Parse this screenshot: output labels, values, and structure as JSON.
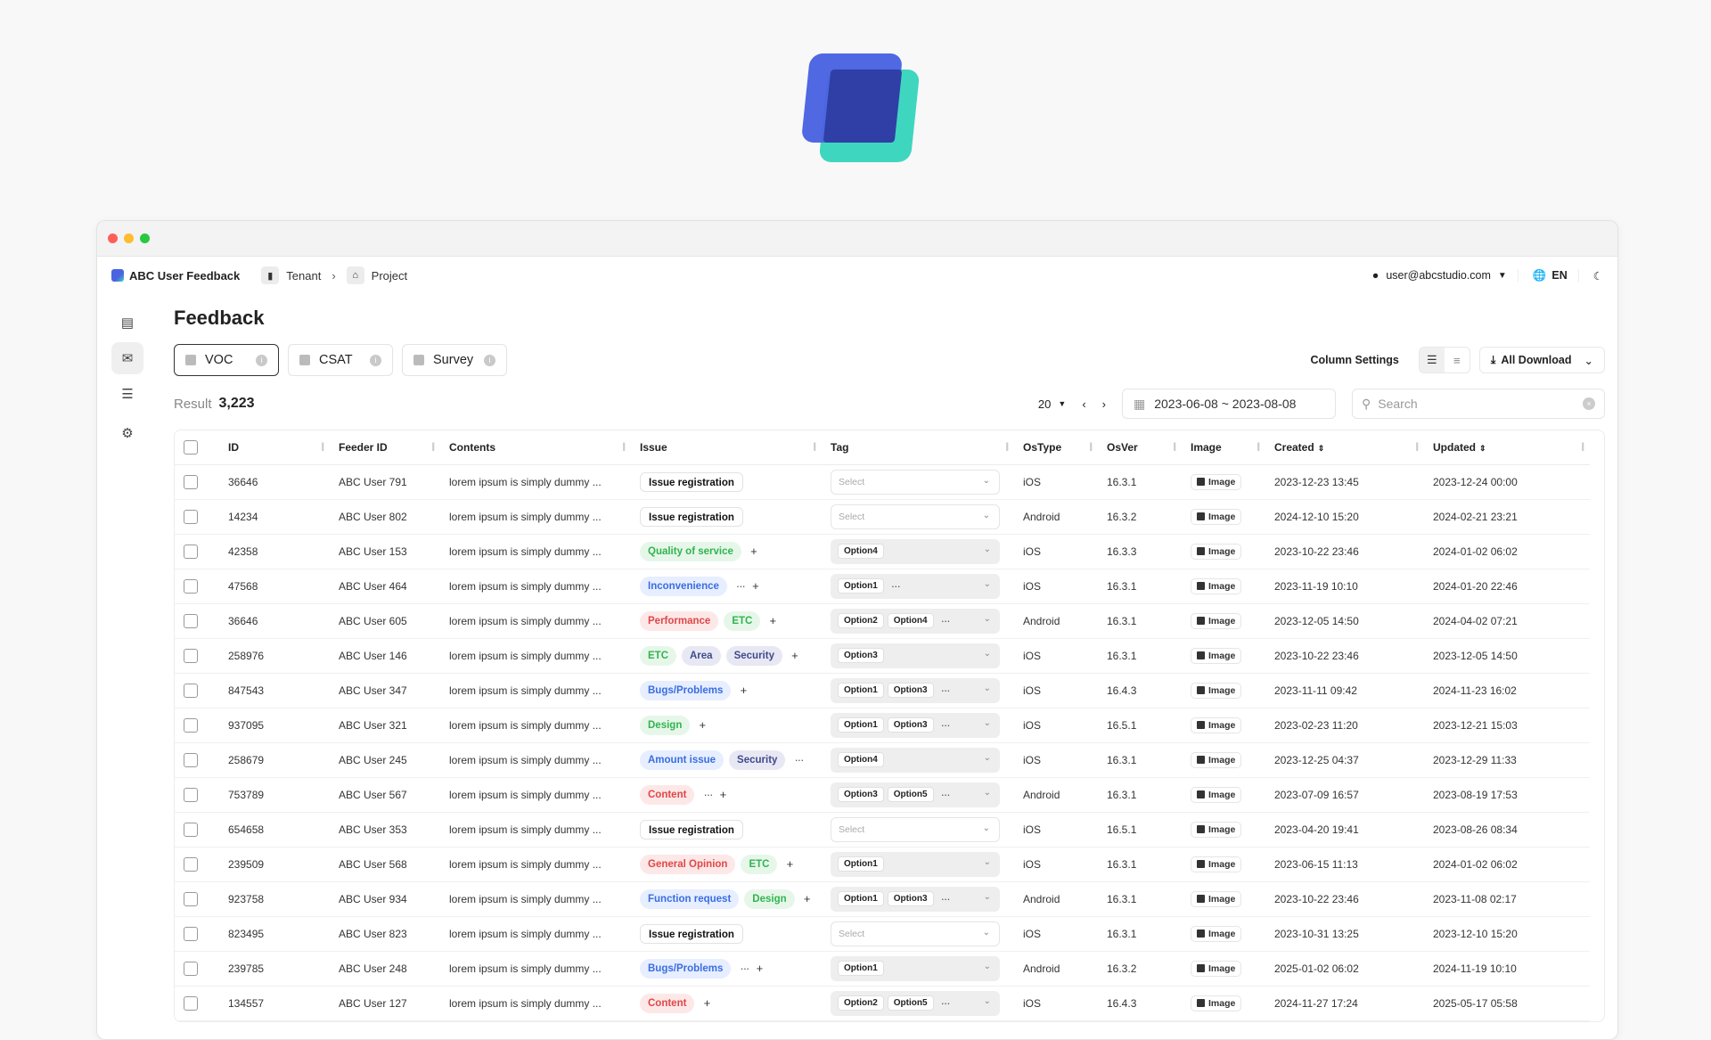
{
  "app": {
    "name": "ABC User Feedback"
  },
  "breadcrumb": {
    "tenant": "Tenant",
    "project": "Project"
  },
  "user": {
    "email": "user@abcstudio.com"
  },
  "lang": {
    "code": "EN"
  },
  "page": {
    "title": "Feedback"
  },
  "tabs": [
    {
      "label": "VOC",
      "active": true
    },
    {
      "label": "CSAT",
      "active": false
    },
    {
      "label": "Survey",
      "active": false
    }
  ],
  "toolbar": {
    "column_settings": "Column Settings",
    "download": "All Download"
  },
  "result": {
    "label": "Result",
    "count": "3,223"
  },
  "pager": {
    "per_page": "20"
  },
  "date_range": "2023-06-08 ~ 2023-08-08",
  "search": {
    "placeholder": "Search"
  },
  "columns": [
    "ID",
    "Feeder ID",
    "Contents",
    "Issue",
    "Tag",
    "OsType",
    "OsVer",
    "Image",
    "Created",
    "Updated"
  ],
  "tag_placeholder": "Select",
  "image_label": "Image",
  "rows": [
    {
      "id": "36646",
      "feeder": "ABC User 791",
      "contents": "lorem ipsum is simply dummy ...",
      "issues": [
        {
          "t": "Issue registration",
          "c": "black"
        }
      ],
      "issue_more": false,
      "issue_plus": false,
      "tags": [],
      "tag_more": false,
      "os": "iOS",
      "ver": "16.3.1",
      "created": "2023-12-23 13:45",
      "updated": "2023-12-24 00:00"
    },
    {
      "id": "14234",
      "feeder": "ABC User 802",
      "contents": "lorem ipsum is simply dummy ...",
      "issues": [
        {
          "t": "Issue registration",
          "c": "black"
        }
      ],
      "issue_more": false,
      "issue_plus": false,
      "tags": [],
      "tag_more": false,
      "os": "Android",
      "ver": "16.3.2",
      "created": "2024-12-10 15:20",
      "updated": "2024-02-21 23:21"
    },
    {
      "id": "42358",
      "feeder": "ABC User 153",
      "contents": "lorem ipsum is simply dummy ...",
      "issues": [
        {
          "t": "Quality of service",
          "c": "green"
        }
      ],
      "issue_more": false,
      "issue_plus": true,
      "tags": [
        "Option4"
      ],
      "tag_more": false,
      "os": "iOS",
      "ver": "16.3.3",
      "created": "2023-10-22 23:46",
      "updated": "2024-01-02 06:02"
    },
    {
      "id": "47568",
      "feeder": "ABC User 464",
      "contents": "lorem ipsum is simply dummy ...",
      "issues": [
        {
          "t": "Inconvenience",
          "c": "blue"
        }
      ],
      "issue_more": true,
      "issue_plus": true,
      "tags": [
        "Option1"
      ],
      "tag_more": true,
      "os": "iOS",
      "ver": "16.3.1",
      "created": "2023-11-19 10:10",
      "updated": "2024-01-20 22:46"
    },
    {
      "id": "36646",
      "feeder": "ABC User 605",
      "contents": "lorem ipsum is simply dummy ...",
      "issues": [
        {
          "t": "Performance",
          "c": "red"
        },
        {
          "t": "ETC",
          "c": "green"
        }
      ],
      "issue_more": false,
      "issue_plus": true,
      "tags": [
        "Option2",
        "Option4"
      ],
      "tag_more": true,
      "os": "Android",
      "ver": "16.3.1",
      "created": "2023-12-05 14:50",
      "updated": "2024-04-02 07:21"
    },
    {
      "id": "258976",
      "feeder": "ABC User 146",
      "contents": "lorem ipsum is simply dummy ...",
      "issues": [
        {
          "t": "ETC",
          "c": "green"
        },
        {
          "t": "Area",
          "c": "purple"
        },
        {
          "t": "Security",
          "c": "purple"
        }
      ],
      "issue_more": false,
      "issue_plus": true,
      "tags": [
        "Option3"
      ],
      "tag_more": false,
      "os": "iOS",
      "ver": "16.3.1",
      "created": "2023-10-22 23:46",
      "updated": "2023-12-05 14:50"
    },
    {
      "id": "847543",
      "feeder": "ABC User 347",
      "contents": "lorem ipsum is simply dummy ...",
      "issues": [
        {
          "t": "Bugs/Problems",
          "c": "blue"
        }
      ],
      "issue_more": false,
      "issue_plus": true,
      "tags": [
        "Option1",
        "Option3"
      ],
      "tag_more": true,
      "os": "iOS",
      "ver": "16.4.3",
      "created": "2023-11-11 09:42",
      "updated": "2024-11-23 16:02"
    },
    {
      "id": "937095",
      "feeder": "ABC User 321",
      "contents": "lorem ipsum is simply dummy ...",
      "issues": [
        {
          "t": "Design",
          "c": "green"
        }
      ],
      "issue_more": false,
      "issue_plus": true,
      "tags": [
        "Option1",
        "Option3"
      ],
      "tag_more": true,
      "os": "iOS",
      "ver": "16.5.1",
      "created": "2023-02-23 11:20",
      "updated": "2023-12-21 15:03"
    },
    {
      "id": "258679",
      "feeder": "ABC User 245",
      "contents": "lorem ipsum is simply dummy ...",
      "issues": [
        {
          "t": "Amount issue",
          "c": "blue"
        },
        {
          "t": "Security",
          "c": "purple"
        }
      ],
      "issue_more": true,
      "issue_plus": false,
      "tags": [
        "Option4"
      ],
      "tag_more": false,
      "os": "iOS",
      "ver": "16.3.1",
      "created": "2023-12-25 04:37",
      "updated": "2023-12-29 11:33"
    },
    {
      "id": "753789",
      "feeder": "ABC User 567",
      "contents": "lorem ipsum is simply dummy ...",
      "issues": [
        {
          "t": "Content",
          "c": "red"
        }
      ],
      "issue_more": true,
      "issue_plus": true,
      "tags": [
        "Option3",
        "Option5"
      ],
      "tag_more": true,
      "os": "Android",
      "ver": "16.3.1",
      "created": "2023-07-09 16:57",
      "updated": "2023-08-19 17:53"
    },
    {
      "id": "654658",
      "feeder": "ABC User 353",
      "contents": "lorem ipsum is simply dummy ...",
      "issues": [
        {
          "t": "Issue registration",
          "c": "black"
        }
      ],
      "issue_more": false,
      "issue_plus": false,
      "tags": [],
      "tag_more": false,
      "os": "iOS",
      "ver": "16.5.1",
      "created": "2023-04-20 19:41",
      "updated": "2023-08-26 08:34"
    },
    {
      "id": "239509",
      "feeder": "ABC User 568",
      "contents": "lorem ipsum is simply dummy ...",
      "issues": [
        {
          "t": "General Opinion",
          "c": "red"
        },
        {
          "t": "ETC",
          "c": "green"
        }
      ],
      "issue_more": false,
      "issue_plus": true,
      "tags": [
        "Option1"
      ],
      "tag_more": false,
      "os": "iOS",
      "ver": "16.3.1",
      "created": "2023-06-15 11:13",
      "updated": "2024-01-02 06:02"
    },
    {
      "id": "923758",
      "feeder": "ABC User 934",
      "contents": "lorem ipsum is simply dummy ...",
      "issues": [
        {
          "t": "Function request",
          "c": "blue"
        },
        {
          "t": "Design",
          "c": "green"
        }
      ],
      "issue_more": false,
      "issue_plus": true,
      "tags": [
        "Option1",
        "Option3"
      ],
      "tag_more": true,
      "os": "Android",
      "ver": "16.3.1",
      "created": "2023-10-22 23:46",
      "updated": "2023-11-08 02:17"
    },
    {
      "id": "823495",
      "feeder": "ABC User 823",
      "contents": "lorem ipsum is simply dummy ...",
      "issues": [
        {
          "t": "Issue registration",
          "c": "black"
        }
      ],
      "issue_more": false,
      "issue_plus": false,
      "tags": [],
      "tag_more": false,
      "os": "iOS",
      "ver": "16.3.1",
      "created": "2023-10-31 13:25",
      "updated": "2023-12-10 15:20"
    },
    {
      "id": "239785",
      "feeder": "ABC User 248",
      "contents": "lorem ipsum is simply dummy ...",
      "issues": [
        {
          "t": "Bugs/Problems",
          "c": "blue"
        }
      ],
      "issue_more": true,
      "issue_plus": true,
      "tags": [
        "Option1"
      ],
      "tag_more": false,
      "os": "Android",
      "ver": "16.3.2",
      "created": "2025-01-02 06:02",
      "updated": "2024-11-19 10:10"
    },
    {
      "id": "134557",
      "feeder": "ABC User 127",
      "contents": "lorem ipsum is simply dummy ...",
      "issues": [
        {
          "t": "Content",
          "c": "red"
        }
      ],
      "issue_more": false,
      "issue_plus": true,
      "tags": [
        "Option2",
        "Option5"
      ],
      "tag_more": true,
      "os": "iOS",
      "ver": "16.4.3",
      "created": "2024-11-27 17:24",
      "updated": "2025-05-17 05:58"
    }
  ]
}
